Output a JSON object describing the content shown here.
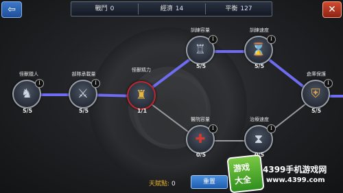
{
  "topbar": {
    "stats": [
      {
        "label": "戰鬥",
        "value": "0"
      },
      {
        "label": "經濟",
        "value": "14"
      },
      {
        "label": "平衡",
        "value": "127"
      }
    ]
  },
  "nav": {
    "back_icon": "back-arrow-icon",
    "close_icon": "close-x-icon",
    "back_glyph": "⇦",
    "close_glyph": "✕"
  },
  "nodes": [
    {
      "id": "n1",
      "label": "怪獸獵人",
      "count": "5/5",
      "badge": "I",
      "icon": "knight-icon",
      "glyph": "♞"
    },
    {
      "id": "n2",
      "label": "部隊承載量",
      "count": "5/5",
      "badge": "I",
      "icon": "soldier-plus-icon",
      "glyph": "⚔"
    },
    {
      "id": "n3",
      "label": "怪獸精力",
      "count": "1/1",
      "badge": "",
      "icon": "golden-monster-icon",
      "glyph": "♜"
    },
    {
      "id": "n4",
      "label": "訓練容量",
      "count": "5/5",
      "badge": "I",
      "icon": "knight-statue-icon",
      "glyph": "♖"
    },
    {
      "id": "n5",
      "label": "訓練速度",
      "count": "5/5",
      "badge": "I",
      "icon": "knight-hourglass-icon",
      "glyph": "⌛"
    },
    {
      "id": "n6",
      "label": "倉庫保護",
      "count": "5/5",
      "badge": "I",
      "icon": "cannon-icon",
      "glyph": "⛨"
    },
    {
      "id": "n7",
      "label": "醫院容量",
      "count": "0/5",
      "badge": "I",
      "icon": "medic-scroll-icon",
      "glyph": "✚"
    },
    {
      "id": "n8",
      "label": "治療速度",
      "count": "0/5",
      "badge": "I",
      "icon": "healer-hourglass-icon",
      "glyph": "⧗"
    }
  ],
  "bottom": {
    "talent_label": "天賦點:",
    "talent_value": "0",
    "reset_label": "重置"
  },
  "watermark": {
    "logo_line1": "游戏",
    "logo_line2": "大全",
    "site": "4399手机游戏网",
    "url": "www.4399.com"
  },
  "colors": {
    "link_active": "#6e6cf0",
    "link_inactive": "#9a9aa0",
    "node_border": "#9a9fa8",
    "accent_red": "#c0272d"
  }
}
